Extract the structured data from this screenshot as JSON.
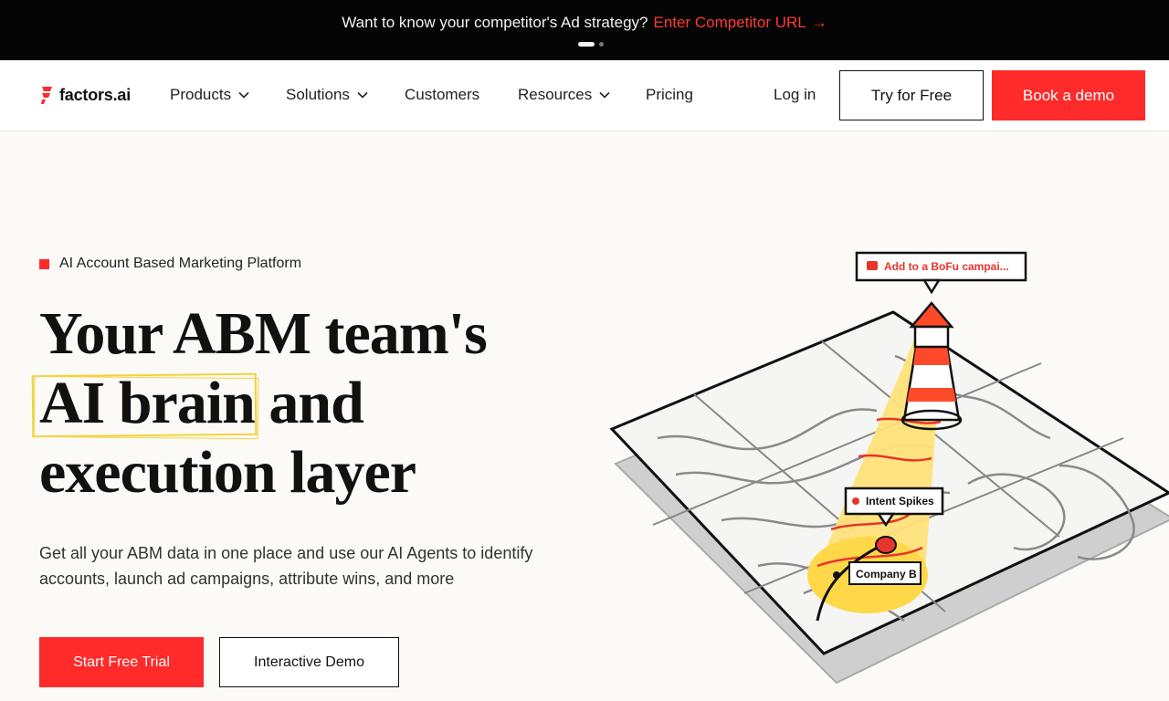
{
  "announcement": {
    "text": "Want to know your competitor's Ad strategy?",
    "link": "Enter Competitor URL",
    "arrow": "→"
  },
  "nav": {
    "logo": "factors.ai",
    "items": [
      {
        "label": "Products",
        "dropdown": true
      },
      {
        "label": "Solutions",
        "dropdown": true
      },
      {
        "label": "Customers",
        "dropdown": false
      },
      {
        "label": "Resources",
        "dropdown": true
      },
      {
        "label": "Pricing",
        "dropdown": false
      }
    ],
    "login": "Log in",
    "try_free": "Try for Free",
    "book_demo": "Book a demo"
  },
  "hero": {
    "eyebrow": "AI Account Based Marketing Platform",
    "headline_line1": "Your ABM team's",
    "headline_highlight": "AI brain",
    "headline_line2_rest": " and",
    "headline_line3": "execution layer",
    "subtitle": "Get all your ABM data in one place and use our AI Agents to identify accounts, launch ad campaigns, attribute wins, and more",
    "cta_primary": "Start Free Trial",
    "cta_secondary": "Interactive Demo"
  },
  "illustration": {
    "callout_top": "Add to a BoFu campai...",
    "callout_intent": "Intent Spikes",
    "callout_company": "Company B"
  },
  "colors": {
    "brand_red": "#ff2a2a",
    "highlight_yellow": "#f4d23c",
    "announce_bg": "#050505"
  }
}
